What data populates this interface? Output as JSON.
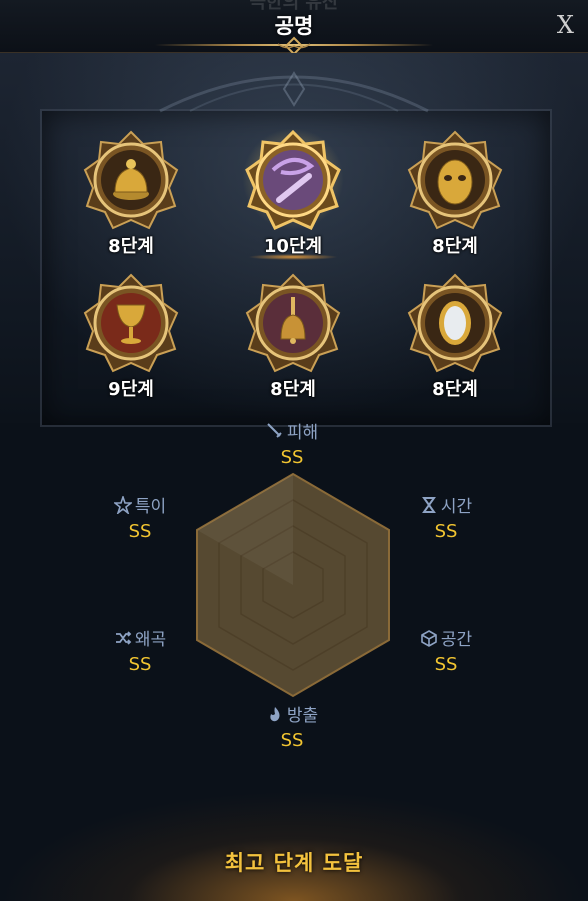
{
  "header": {
    "ghost_title": "극한의 유산",
    "title": "공명",
    "close_label": "X"
  },
  "relics": [
    {
      "level": "8단계",
      "icon": "incense-burner-icon",
      "selected": false
    },
    {
      "level": "10단계",
      "icon": "whip-icon",
      "selected": true
    },
    {
      "level": "8단계",
      "icon": "golden-mask-icon",
      "selected": false
    },
    {
      "level": "9단계",
      "icon": "chalice-icon",
      "selected": false
    },
    {
      "level": "8단계",
      "icon": "bell-icon",
      "selected": false
    },
    {
      "level": "8단계",
      "icon": "mirror-icon",
      "selected": false
    }
  ],
  "stats": {
    "damage": {
      "name": "피해",
      "grade": "SS",
      "icon": "sword-icon"
    },
    "time": {
      "name": "시간",
      "grade": "SS",
      "icon": "hourglass-icon"
    },
    "space": {
      "name": "공간",
      "grade": "SS",
      "icon": "cube-icon"
    },
    "emission": {
      "name": "방출",
      "grade": "SS",
      "icon": "flame-icon"
    },
    "distortion": {
      "name": "왜곡",
      "grade": "SS",
      "icon": "shuffle-icon"
    },
    "special": {
      "name": "특이",
      "grade": "SS",
      "icon": "star-icon"
    }
  },
  "footer": {
    "status": "최고 단계 도달"
  },
  "colors": {
    "grade": "#f2c531",
    "stat_label": "#8ea3c4",
    "gold": "#c89a48"
  }
}
